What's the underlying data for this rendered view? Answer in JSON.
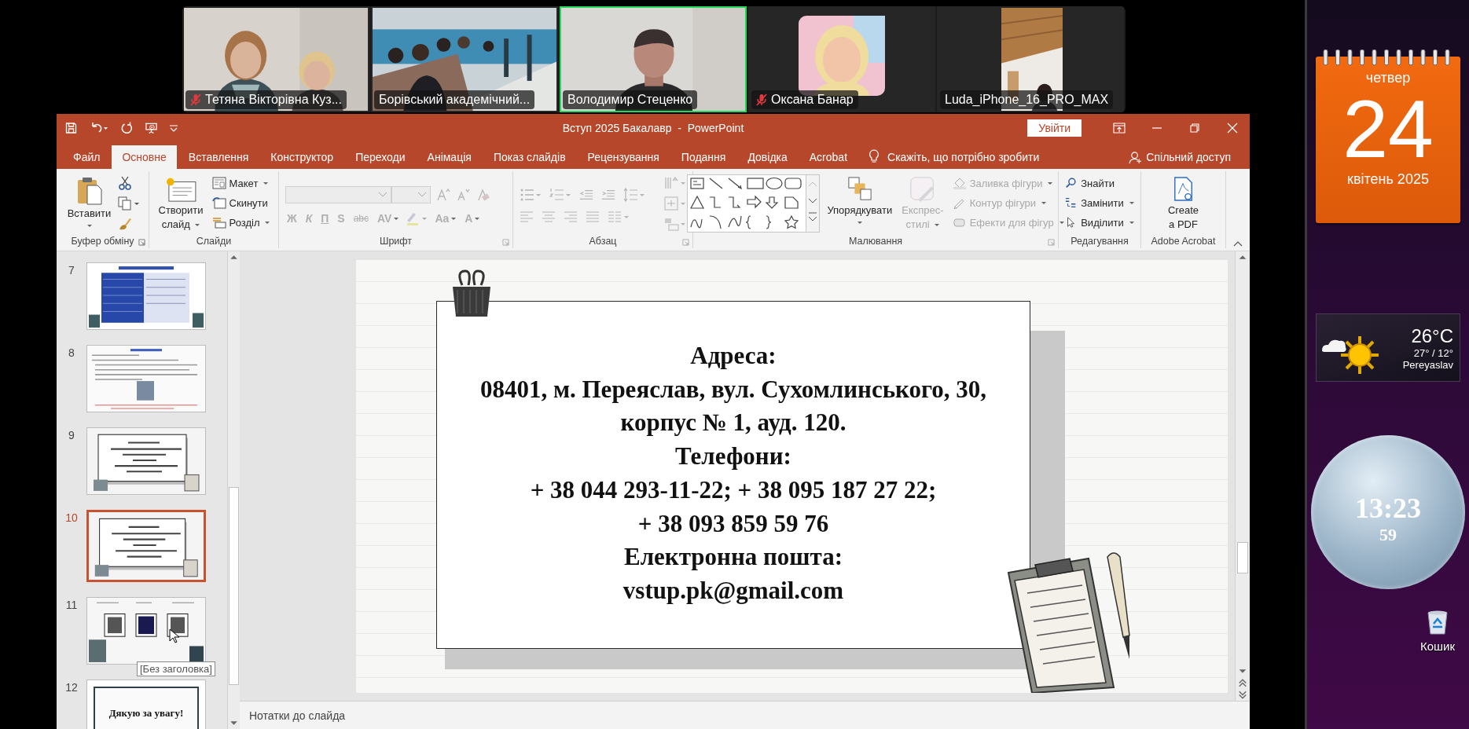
{
  "video_call": {
    "participants": [
      {
        "name": "Тетяна Вікторівна Куз...",
        "muted": true,
        "speaking": false
      },
      {
        "name": "Борівський академічний...",
        "muted": false,
        "speaking": false
      },
      {
        "name": "Володимир Стеценко",
        "muted": false,
        "speaking": true
      },
      {
        "name": "Оксана Банар",
        "muted": true,
        "speaking": false
      },
      {
        "name": "Luda_iPhone_16_PRO_MAX",
        "muted": false,
        "speaking": false
      }
    ]
  },
  "window": {
    "title": "Вступ 2025 Бакалавр  -  PowerPoint",
    "sign_in": "Увійти"
  },
  "tabs": [
    {
      "label": "Файл",
      "selected": false
    },
    {
      "label": "Основне",
      "selected": true
    },
    {
      "label": "Вставлення",
      "selected": false
    },
    {
      "label": "Конструктор",
      "selected": false
    },
    {
      "label": "Переходи",
      "selected": false
    },
    {
      "label": "Анімація",
      "selected": false
    },
    {
      "label": "Показ слайдів",
      "selected": false
    },
    {
      "label": "Рецензування",
      "selected": false
    },
    {
      "label": "Подання",
      "selected": false
    },
    {
      "label": "Довідка",
      "selected": false
    },
    {
      "label": "Acrobat",
      "selected": false
    }
  ],
  "tell_me": "Скажіть, що потрібно зробити",
  "share": "Спільний доступ",
  "ribbon": {
    "clipboard": {
      "label": "Буфер обміну",
      "paste": "Вставити"
    },
    "slides": {
      "label": "Слайди",
      "new_slide": [
        "Створити",
        "слайд"
      ],
      "layout": "Макет",
      "reset": "Скинути",
      "section": "Розділ"
    },
    "font": {
      "label": "Шрифт",
      "disabled": true,
      "buttons": [
        "Ж",
        "К",
        "П",
        "S",
        "abc",
        "AV",
        "Aa",
        "A"
      ]
    },
    "paragraph": {
      "label": "Абзац"
    },
    "drawing": {
      "label": "Малювання",
      "arrange": "Упорядкувати",
      "quick_styles": {
        "lines": [
          "Експрес-",
          "стилі"
        ],
        "disabled": true
      },
      "shape_format": [
        {
          "label": "Заливка фігури",
          "disabled": true
        },
        {
          "label": "Контур фігури",
          "disabled": true
        },
        {
          "label": "Ефекти для фігур",
          "disabled": true
        }
      ]
    },
    "editing": {
      "label": "Редагування",
      "items": [
        "Знайти",
        "Замінити",
        "Виділити"
      ]
    },
    "acrobat": {
      "label": "Adobe Acrobat",
      "create": [
        "Create",
        "a PDF"
      ]
    }
  },
  "slides": [
    {
      "number": "7",
      "selected": false,
      "kind": "table"
    },
    {
      "number": "8",
      "selected": false,
      "kind": "text"
    },
    {
      "number": "9",
      "selected": false,
      "kind": "card"
    },
    {
      "number": "10",
      "selected": true,
      "kind": "card"
    },
    {
      "number": "11",
      "selected": false,
      "kind": "qr"
    },
    {
      "number": "12",
      "selected": false,
      "kind": "title",
      "title": "Дякую за увагу!"
    }
  ],
  "tooltip": "[Без заголовка]",
  "slide": {
    "lines": [
      "Адреса:",
      "08401, м. Переяслав, вул. Сухомлинського, 30,",
      "корпус № 1, ауд. 120.",
      "Телефони:",
      "+ 38 044 293-11-22; + 38 095 187 27 22;",
      "+ 38 093 859 59 76",
      "Електронна пошта:",
      "vstup.pk@gmail.com"
    ]
  },
  "notes": "Нотатки до слайда",
  "desktop": {
    "calendar": {
      "weekday": "четвер",
      "day": "24",
      "month_year": "квітень 2025"
    },
    "weather": {
      "temperature": "26°C",
      "range": "27° / 12°",
      "city": "Pereyaslav"
    },
    "clock": {
      "time": "13:23",
      "seconds": "59"
    },
    "recycle_bin": "Кошик"
  }
}
